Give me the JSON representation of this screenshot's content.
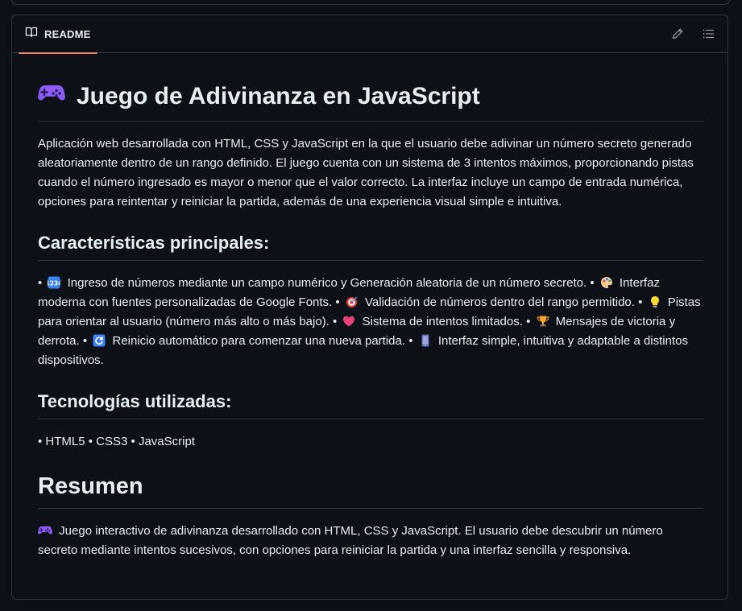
{
  "header": {
    "tab_label": "README",
    "icons": [
      "book-icon",
      "pencil-icon",
      "list-icon"
    ]
  },
  "readme": {
    "title": "Juego de Adivinanza en JavaScript",
    "intro": "Aplicación web desarrollada con HTML, CSS y JavaScript en la que el usuario debe adivinar un número secreto generado aleatoriamente dentro de un rango definido. El juego cuenta con un sistema de 3 intentos máximos, proporcionando pistas cuando el número ingresado es mayor o menor que el valor correcto. La interfaz incluye un campo de entrada numérica, opciones para reintentar y reiniciar la partida, además de una experiencia visual simple e intuitiva.",
    "features_heading": "Características principales:",
    "features": [
      {
        "icon": "numbers-icon",
        "text": "Ingreso de números mediante un campo numérico y Generación aleatoria de un número secreto."
      },
      {
        "icon": "palette-icon",
        "text": "Interfaz moderna con fuentes personalizadas de Google Fonts."
      },
      {
        "icon": "target-icon",
        "text": "Validación de números dentro del rango permitido."
      },
      {
        "icon": "lightbulb-icon",
        "text": "Pistas para orientar al usuario (número más alto o más bajo)."
      },
      {
        "icon": "heart-icon",
        "text": "Sistema de intentos limitados."
      },
      {
        "icon": "trophy-icon",
        "text": "Mensajes de victoria y derrota."
      },
      {
        "icon": "refresh-icon",
        "text": "Reinicio automático para comenzar una nueva partida."
      },
      {
        "icon": "phone-icon",
        "text": "Interfaz simple, intuitiva y adaptable a distintos dispositivos."
      }
    ],
    "bullet": "•",
    "tech_heading": "Tecnologías utilizadas:",
    "tech_line": "• HTML5 • CSS3 • JavaScript",
    "summary_heading": "Resumen",
    "summary": "Juego interactivo de adivinanza desarrollado con HTML, CSS y JavaScript. El usuario debe descubrir un número secreto mediante intentos sucesivos, con opciones para reiniciar la partida y una interfaz sencilla y responsiva.",
    "colors": {
      "background": "#0d1117",
      "border": "#30363d",
      "text": "#e6edf3",
      "muted_icon": "#9198a1",
      "tab_underline": "#f78166"
    }
  }
}
